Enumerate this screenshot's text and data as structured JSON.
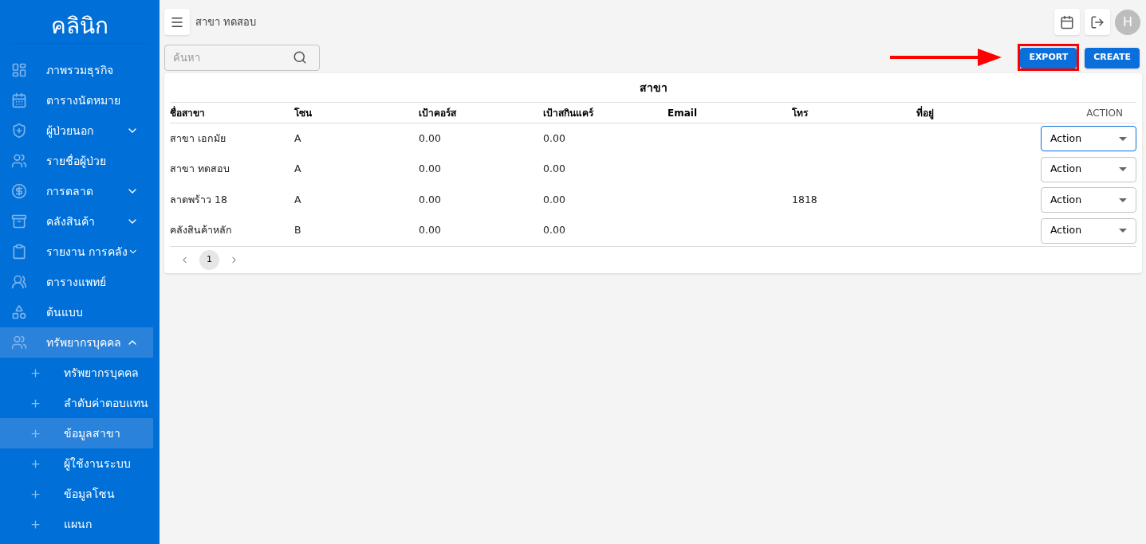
{
  "sidebar": {
    "logo": "คลินิก",
    "items": [
      {
        "kind": "dashboard",
        "label": "ภาพรวมธุรกิจ",
        "expandable": false,
        "expanded": false
      },
      {
        "kind": "calendar",
        "label": "ตารางนัดหมาย",
        "expandable": false,
        "expanded": false
      },
      {
        "kind": "shield",
        "label": "ผู้ป่วยนอก",
        "expandable": true,
        "expanded": false
      },
      {
        "kind": "patients",
        "label": "รายชื่อผู้ป่วย",
        "expandable": false,
        "expanded": false
      },
      {
        "kind": "money",
        "label": "การตลาด",
        "expandable": true,
        "expanded": false
      },
      {
        "kind": "archive",
        "label": "คลังสินค้า",
        "expandable": true,
        "expanded": false
      },
      {
        "kind": "clipboard",
        "label": "รายงาน การคลัง",
        "expandable": true,
        "expanded": false
      },
      {
        "kind": "team",
        "label": "ตารางแพทย์",
        "expandable": false,
        "expanded": false
      },
      {
        "kind": "shapes",
        "label": "ต้นแบบ",
        "expandable": false,
        "expanded": false
      },
      {
        "kind": "people",
        "label": "ทรัพยากรบุคคล",
        "expandable": true,
        "expanded": true,
        "children": [
          {
            "label": "ทรัพยากรบุคคล",
            "selected": false
          },
          {
            "label": "ลำดับค่าตอบแทน",
            "selected": false
          },
          {
            "label": "ข้อมูลสาขา",
            "selected": true
          },
          {
            "label": "ผู้ใช้งานระบบ",
            "selected": false
          },
          {
            "label": "ข้อมูลโซน",
            "selected": false
          },
          {
            "label": "แผนก",
            "selected": false
          }
        ]
      }
    ]
  },
  "header": {
    "breadcrumb": "สาขา ทดสอบ",
    "avatar": "H"
  },
  "search": {
    "placeholder": "ค้นหา"
  },
  "buttons": [
    {
      "label": "EXPORT",
      "highlighted": true
    },
    {
      "label": "CREATE",
      "highlighted": false
    }
  ],
  "table": {
    "title": "สาขา",
    "columns": [
      "ชื่อสาขา",
      "โซน",
      "เป้าคอร์ส",
      "เป้าสกินแคร์",
      "Email",
      "โทร",
      "ที่อยู่",
      "ACTION"
    ],
    "rows": [
      {
        "cells": [
          "สาขา เอกมัย",
          "A",
          "0.00",
          "0.00",
          "",
          "",
          "",
          ""
        ],
        "action": "Action",
        "focused": true
      },
      {
        "cells": [
          "สาขา ทดสอบ",
          "A",
          "0.00",
          "0.00",
          "",
          "",
          "",
          ""
        ],
        "action": "Action",
        "focused": false
      },
      {
        "cells": [
          "ลาดพร้าว 18",
          "A",
          "0.00",
          "0.00",
          "",
          "1818",
          "",
          ""
        ],
        "action": "Action",
        "focused": false
      },
      {
        "cells": [
          "คลังสินค้าหลัก",
          "B",
          "0.00",
          "0.00",
          "",
          "",
          "",
          ""
        ],
        "action": "Action",
        "focused": false
      }
    ]
  },
  "pagination": {
    "pages": [
      {
        "label": "1",
        "selected": true
      }
    ]
  }
}
